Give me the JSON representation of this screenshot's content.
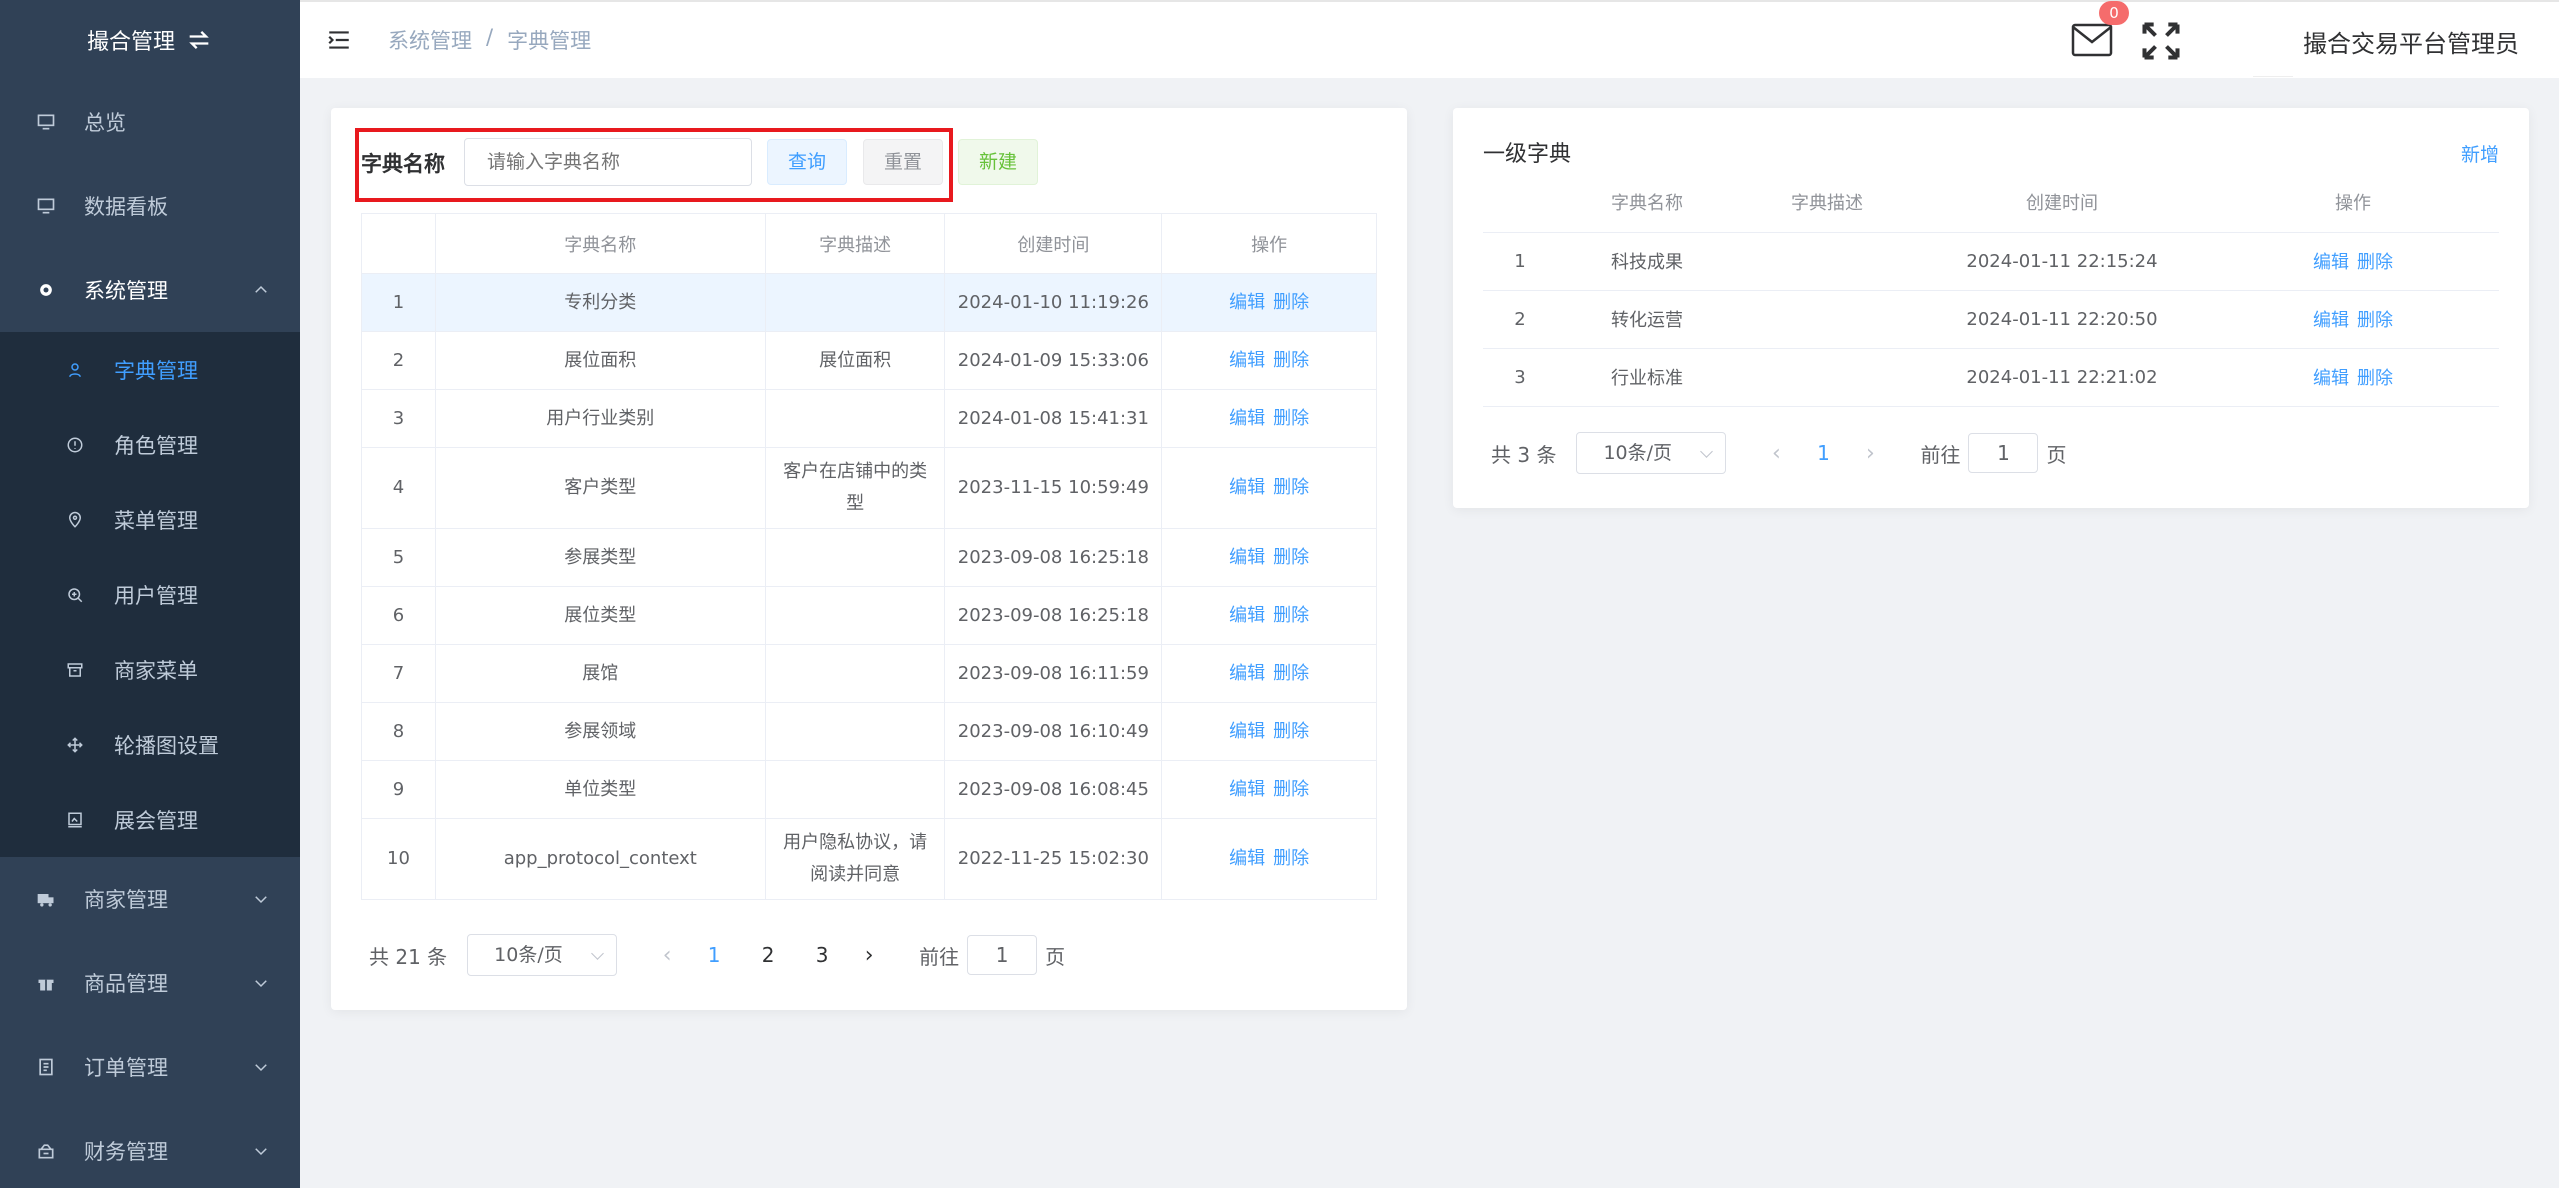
{
  "sidebar": {
    "brand": "撮合管理",
    "items": [
      {
        "label": "总览",
        "icon": "monitor-icon"
      },
      {
        "label": "数据看板",
        "icon": "monitor-icon"
      },
      {
        "label": "系统管理",
        "icon": "gear-icon"
      }
    ],
    "submenu": [
      {
        "label": "字典管理",
        "icon": "user-icon"
      },
      {
        "label": "角色管理",
        "icon": "info-icon"
      },
      {
        "label": "菜单管理",
        "icon": "location-icon"
      },
      {
        "label": "用户管理",
        "icon": "zoom-icon"
      },
      {
        "label": "商家菜单",
        "icon": "box-icon"
      },
      {
        "label": "轮播图设置",
        "icon": "move-icon"
      },
      {
        "label": "展会管理",
        "icon": "picture-icon"
      }
    ],
    "bottom_items": [
      {
        "label": "商家管理",
        "icon": "truck-icon"
      },
      {
        "label": "商品管理",
        "icon": "gift-icon"
      },
      {
        "label": "订单管理",
        "icon": "document-icon"
      },
      {
        "label": "财务管理",
        "icon": "wallet-icon"
      }
    ]
  },
  "header": {
    "breadcrumb": [
      "系统管理",
      "/",
      "字典管理"
    ],
    "mail_badge": "0",
    "username": "撮合交易平台管理员"
  },
  "left_card": {
    "search_label": "字典名称",
    "search_placeholder": "请输入字典名称",
    "query_label": "查询",
    "reset_label": "重置",
    "new_label": "新建",
    "columns": [
      "",
      "字典名称",
      "字典描述",
      "创建时间",
      "操作"
    ],
    "edit_label": "编辑",
    "delete_label": "删除",
    "rows": [
      {
        "no": "1",
        "name": "专利分类",
        "desc": "",
        "time": "2024-01-10 11:19:26"
      },
      {
        "no": "2",
        "name": "展位面积",
        "desc": "展位面积",
        "time": "2024-01-09 15:33:06"
      },
      {
        "no": "3",
        "name": "用户行业类别",
        "desc": "",
        "time": "2024-01-08 15:41:31"
      },
      {
        "no": "4",
        "name": "客户类型",
        "desc": "客户在店铺中的类型",
        "time": "2023-11-15 10:59:49"
      },
      {
        "no": "5",
        "name": "参展类型",
        "desc": "",
        "time": "2023-09-08 16:25:18"
      },
      {
        "no": "6",
        "name": "展位类型",
        "desc": "",
        "time": "2023-09-08 16:25:18"
      },
      {
        "no": "7",
        "name": "展馆",
        "desc": "",
        "time": "2023-09-08 16:11:59"
      },
      {
        "no": "8",
        "name": "参展领域",
        "desc": "",
        "time": "2023-09-08 16:10:49"
      },
      {
        "no": "9",
        "name": "单位类型",
        "desc": "",
        "time": "2023-09-08 16:08:45"
      },
      {
        "no": "10",
        "name": "app_protocol_context",
        "desc": "用户隐私协议，请阅读并同意",
        "time": "2022-11-25 15:02:30"
      }
    ],
    "pager": {
      "total": "共 21 条",
      "size": "10条/页",
      "pages": [
        "1",
        "2",
        "3"
      ],
      "goto": "前往",
      "goto_value": "1",
      "page_unit": "页"
    }
  },
  "right_card": {
    "title": "一级字典",
    "add_label": "新增",
    "columns": [
      "",
      "字典名称",
      "字典描述",
      "创建时间",
      "操作"
    ],
    "rows": [
      {
        "no": "1",
        "name": "科技成果",
        "desc": "",
        "time": "2024-01-11 22:15:24"
      },
      {
        "no": "2",
        "name": "转化运营",
        "desc": "",
        "time": "2024-01-11 22:20:50"
      },
      {
        "no": "3",
        "name": "行业标准",
        "desc": "",
        "time": "2024-01-11 22:21:02"
      }
    ],
    "pager": {
      "total": "共 3 条",
      "size": "10条/页",
      "pages": [
        "1"
      ],
      "goto": "前往",
      "goto_value": "1",
      "page_unit": "页"
    }
  },
  "colors": {
    "accent": "#409eff",
    "sidebar": "#304156",
    "submenu": "#1f2d3d",
    "highlight": "#e8191e"
  }
}
